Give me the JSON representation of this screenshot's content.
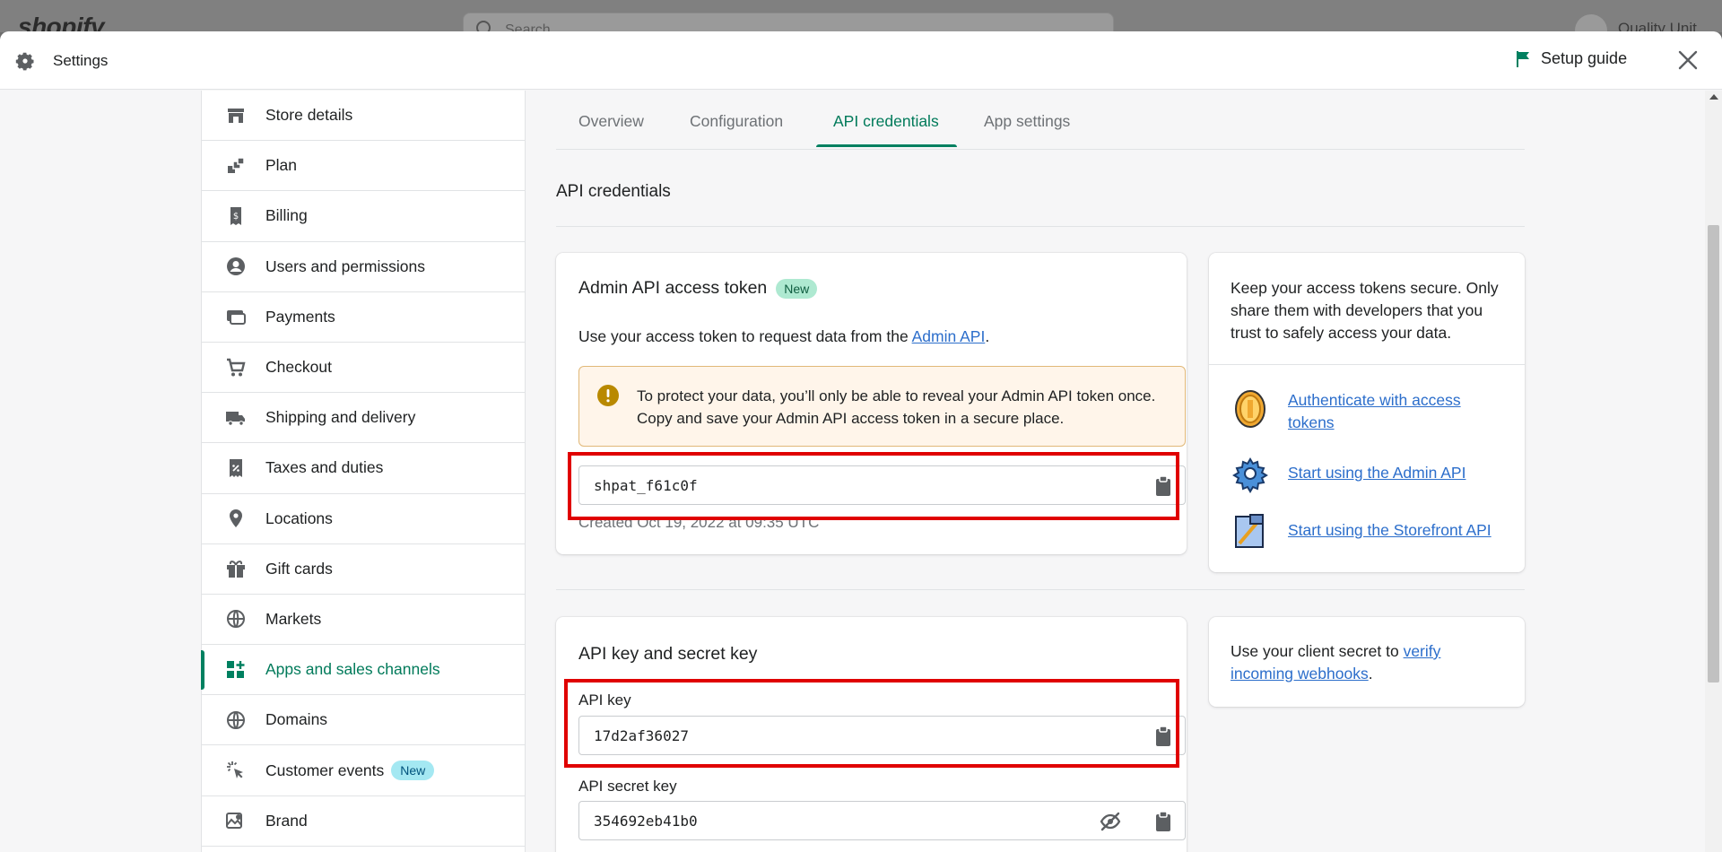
{
  "shell": {
    "logo": "shopify",
    "search_placeholder": "Search",
    "store_name": "Quality Unit"
  },
  "header": {
    "title": "Settings",
    "setup_guide": "Setup guide"
  },
  "sidebar": {
    "items": [
      {
        "label": "Store details",
        "icon": "store-icon"
      },
      {
        "label": "Plan",
        "icon": "plan-icon"
      },
      {
        "label": "Billing",
        "icon": "billing-icon"
      },
      {
        "label": "Users and permissions",
        "icon": "user-icon"
      },
      {
        "label": "Payments",
        "icon": "payments-icon"
      },
      {
        "label": "Checkout",
        "icon": "cart-icon"
      },
      {
        "label": "Shipping and delivery",
        "icon": "truck-icon"
      },
      {
        "label": "Taxes and duties",
        "icon": "tax-icon"
      },
      {
        "label": "Locations",
        "icon": "location-pin-icon"
      },
      {
        "label": "Gift cards",
        "icon": "gift-icon"
      },
      {
        "label": "Markets",
        "icon": "globe-icon"
      },
      {
        "label": "Apps and sales channels",
        "icon": "apps-icon",
        "active": true
      },
      {
        "label": "Domains",
        "icon": "domain-globe-icon"
      },
      {
        "label": "Customer events",
        "icon": "cursor-click-icon",
        "badge": "New"
      },
      {
        "label": "Brand",
        "icon": "brand-icon"
      }
    ]
  },
  "tabs": [
    {
      "label": "Overview"
    },
    {
      "label": "Configuration"
    },
    {
      "label": "API credentials",
      "active": true
    },
    {
      "label": "App settings"
    }
  ],
  "section": {
    "title": "API credentials"
  },
  "admin_token_card": {
    "title": "Admin API access token",
    "badge": "New",
    "desc_prefix": "Use your access token to request data from the ",
    "desc_link": "Admin API",
    "desc_suffix": ".",
    "warning": "To protect your data, you’ll only be able to reveal your Admin API token once. Copy and save your Admin API access token in a secure place.",
    "token_value": "shpat_f61c0f",
    "created": "Created Oct 19, 2022 at 09:35 UTC"
  },
  "tips_card": {
    "text": "Keep your access tokens secure. Only share them with developers that you trust to safely access your data.",
    "resources": [
      {
        "label": "Authenticate with access tokens",
        "icon": "coin-icon"
      },
      {
        "label": "Start using the Admin API",
        "icon": "cog-icon"
      },
      {
        "label": "Start using the Storefront API",
        "icon": "storefront-icon"
      }
    ]
  },
  "api_key_card": {
    "title": "API key and secret key",
    "api_key_label": "API key",
    "api_key_value": "17d2af36027",
    "secret_label": "API secret key",
    "secret_value": "354692eb41b0"
  },
  "webhook_card": {
    "prefix": "Use your client secret to ",
    "link": "verify incoming webhooks",
    "suffix": "."
  },
  "colors": {
    "accent": "#008060",
    "link": "#2c6ecb",
    "highlight": "#e00000",
    "warning_bg": "#fff5ea"
  }
}
